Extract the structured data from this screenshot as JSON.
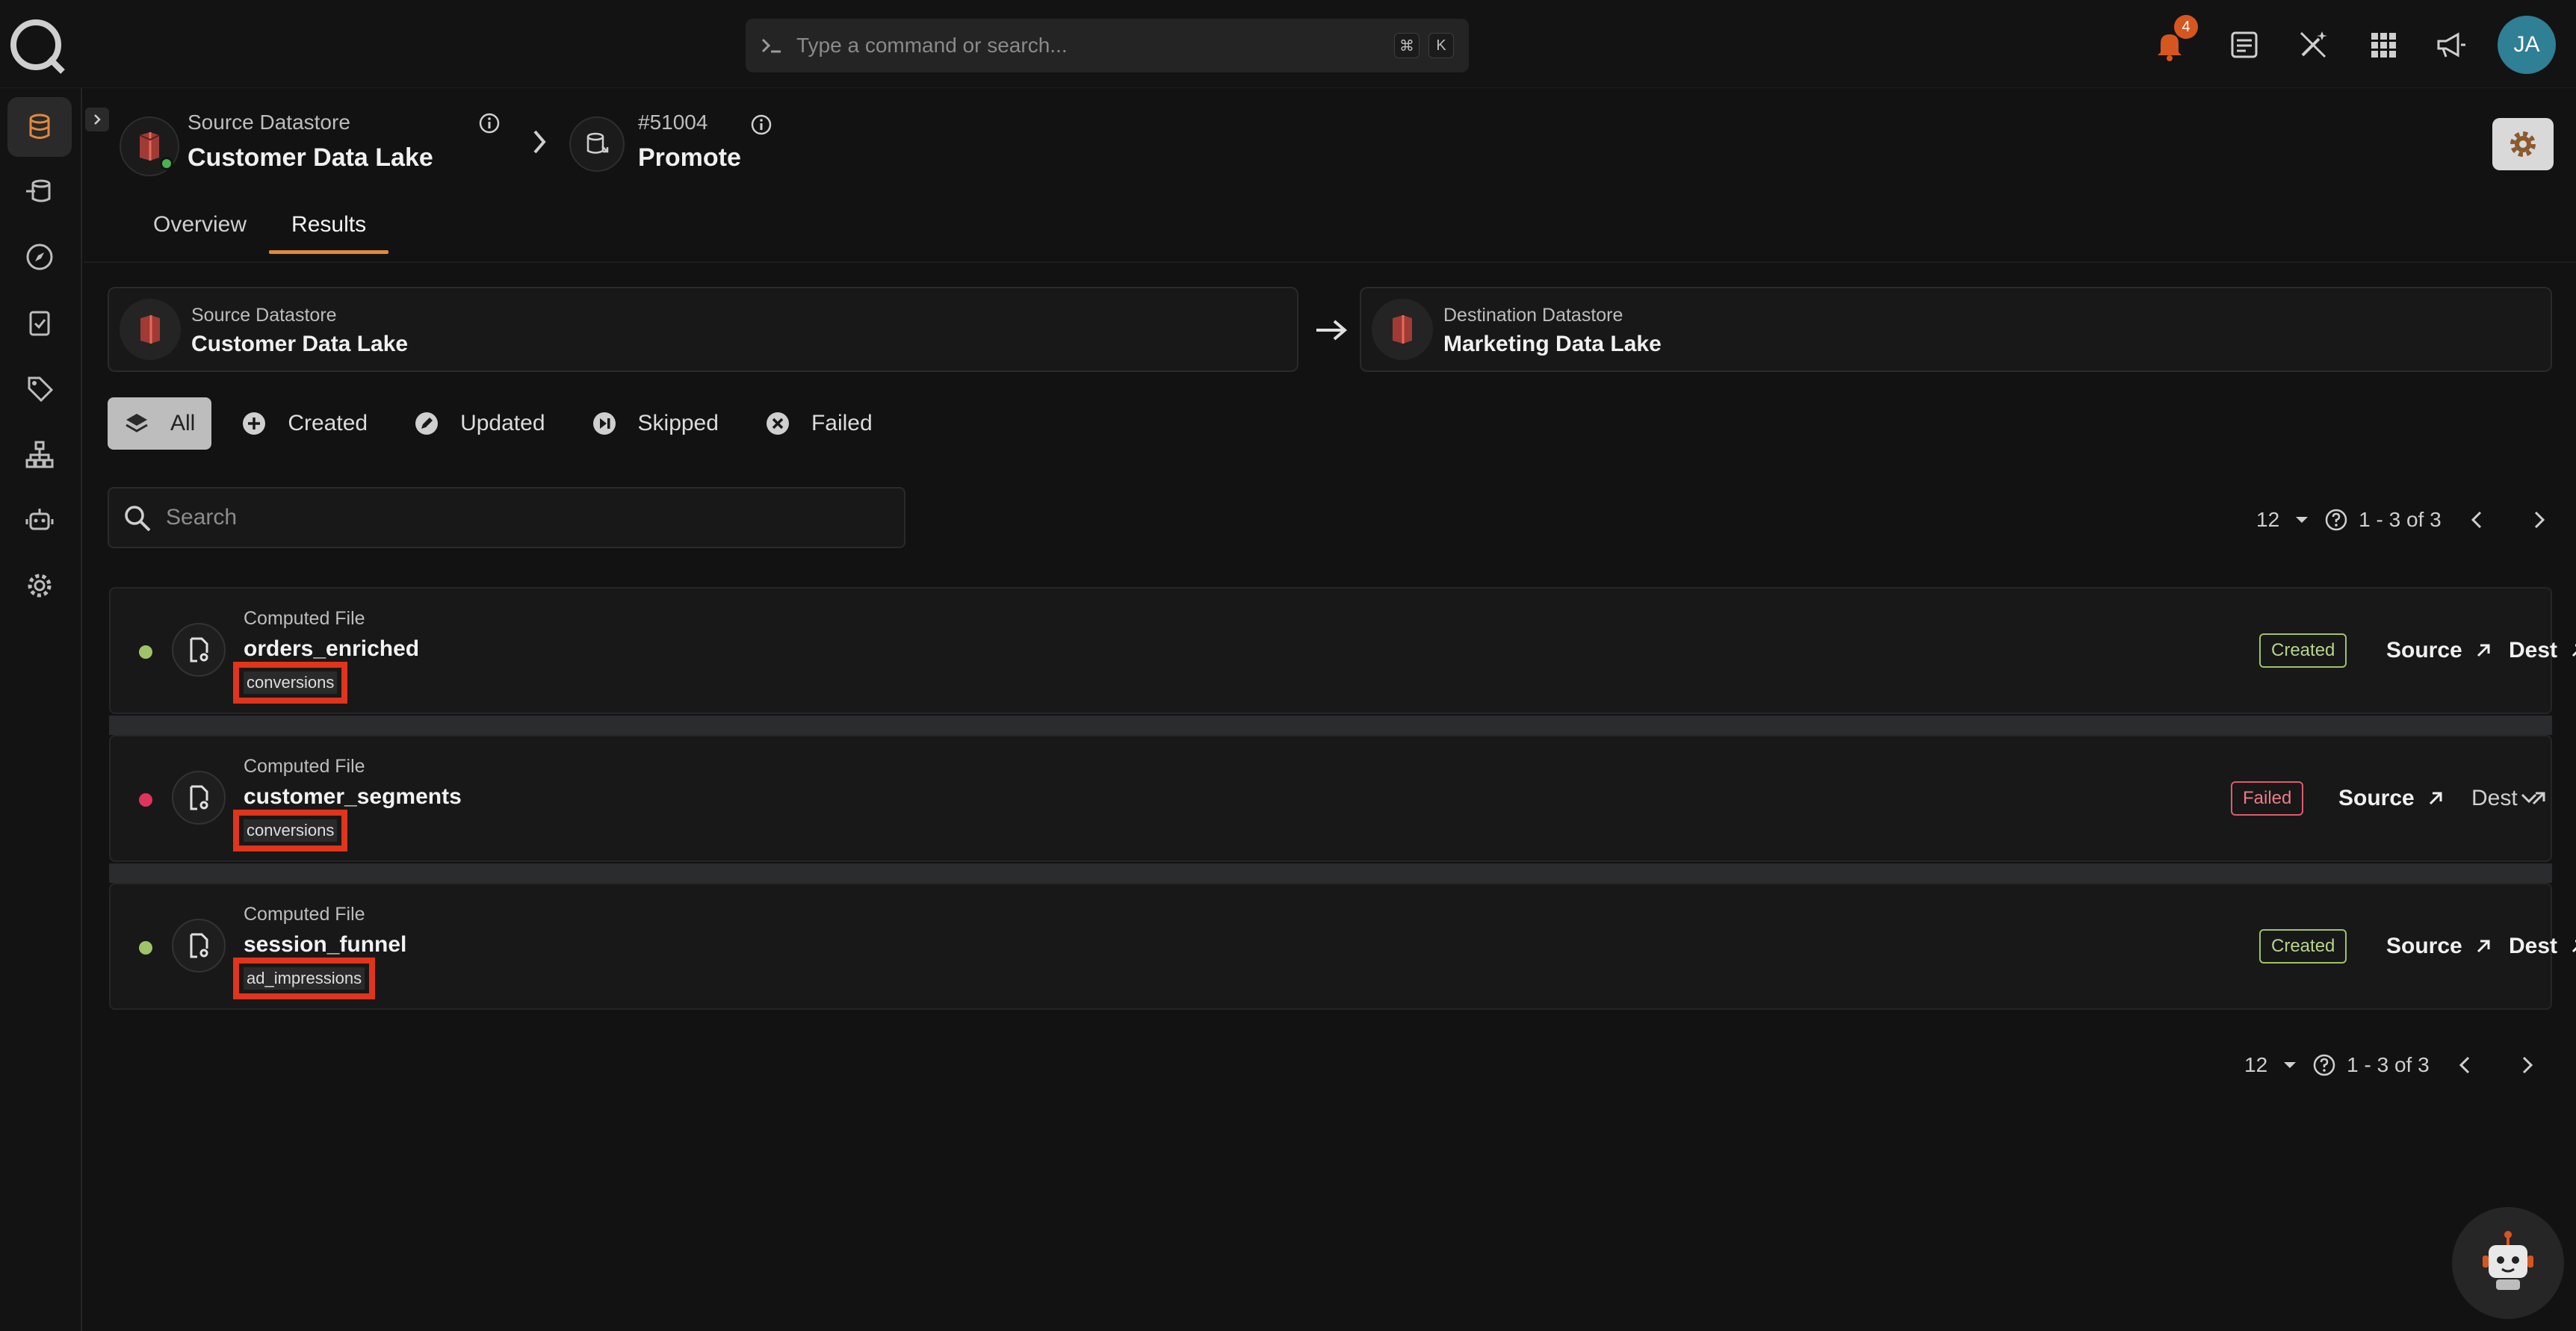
{
  "command_bar": {
    "placeholder": "Type a command or search...",
    "key1": "⌘",
    "key2": "K"
  },
  "topbar": {
    "notification_count": "4",
    "avatar_initials": "JA"
  },
  "breadcrumb": {
    "source_label": "Source Datastore",
    "source_name": "Customer Data Lake",
    "op_id": "#51004",
    "op_name": "Promote"
  },
  "tabs": [
    {
      "label": "Overview"
    },
    {
      "label": "Results"
    }
  ],
  "source_card": {
    "label": "Source Datastore",
    "name": "Customer Data Lake"
  },
  "dest_card": {
    "label": "Destination Datastore",
    "name": "Marketing Data Lake"
  },
  "filters": [
    {
      "label": "All"
    },
    {
      "label": "Created"
    },
    {
      "label": "Updated"
    },
    {
      "label": "Skipped"
    },
    {
      "label": "Failed"
    }
  ],
  "search": {
    "placeholder": "Search"
  },
  "pagination": {
    "per_page": "12",
    "range": "1 - 3 of 3"
  },
  "rows": [
    {
      "kind": "Computed File",
      "name": "orders_enriched",
      "tag": "conversions",
      "status": "Created",
      "source": "Source",
      "dest": "Dest"
    },
    {
      "kind": "Computed File",
      "name": "customer_segments",
      "tag": "conversions",
      "status": "Failed",
      "source": "Source",
      "dest": "Dest"
    },
    {
      "kind": "Computed File",
      "name": "session_funnel",
      "tag": "ad_impressions",
      "status": "Created",
      "source": "Source",
      "dest": "Dest"
    }
  ],
  "colors": {
    "accent": "#e08a3c",
    "created": "#9fc26a",
    "failed": "#e05a6a",
    "highlight": "#e0341c"
  }
}
